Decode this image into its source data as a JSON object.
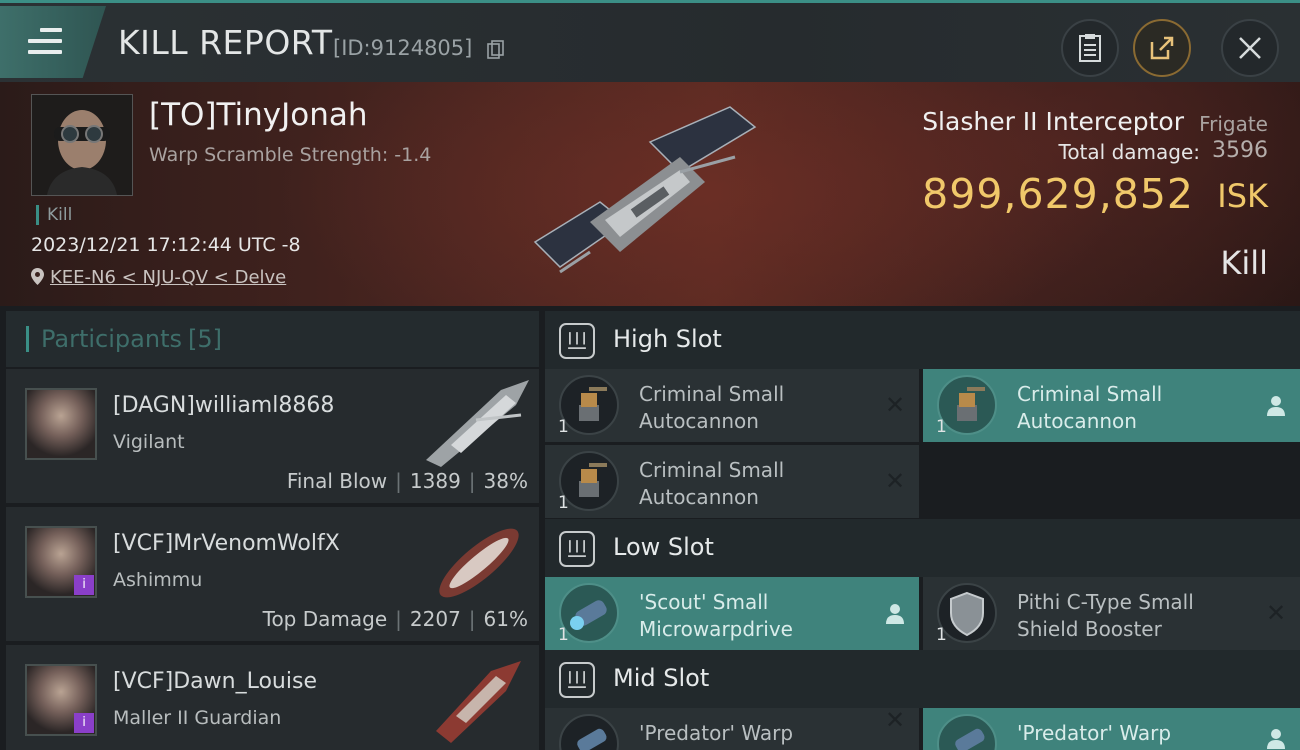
{
  "header": {
    "title": "KILL REPORT",
    "id_text": "[ID:9124805]"
  },
  "victim": {
    "name": "[TO]TinyJonah",
    "warp_scramble": "Warp Scramble Strength: -1.4",
    "tag": "Kill",
    "timestamp": "2023/12/21 17:12:44 UTC -8",
    "location": "KEE-N6 < NJU-QV < Delve",
    "ship": "Slasher II Interceptor",
    "ship_class": "Frigate",
    "total_damage_label": "Total damage:",
    "total_damage": "3596",
    "isk_value": "899,629,852",
    "isk_unit": "ISK",
    "result": "Kill"
  },
  "participants": {
    "label": "Participants",
    "count": "[5]",
    "items": [
      {
        "name": "[DAGN]williaml8868",
        "ship": "Vigilant",
        "role": "Final Blow",
        "damage": "1389",
        "percent": "38%"
      },
      {
        "name": "[VCF]MrVenomWolfX",
        "ship": "Ashimmu",
        "role": "Top Damage",
        "damage": "2207",
        "percent": "61%"
      },
      {
        "name": "[VCF]Dawn_Louise",
        "ship": "Maller II Guardian"
      }
    ]
  },
  "slots": {
    "high": {
      "label": "High Slot",
      "modules": [
        {
          "qty": "1",
          "name_line1": "Criminal Small",
          "name_line2": "Autocannon",
          "status": "dropped"
        },
        {
          "qty": "1",
          "name_line1": "Criminal Small",
          "name_line2": "Autocannon",
          "status": "looted"
        },
        {
          "qty": "1",
          "name_line1": "Criminal Small",
          "name_line2": "Autocannon",
          "status": "dropped"
        }
      ]
    },
    "low": {
      "label": "Low Slot",
      "modules": [
        {
          "qty": "1",
          "name_line1": "'Scout' Small",
          "name_line2": "Microwarpdrive",
          "status": "looted"
        },
        {
          "qty": "1",
          "name_line1": "Pithi C-Type Small",
          "name_line2": "Shield Booster",
          "status": "dropped"
        }
      ]
    },
    "mid": {
      "label": "Mid Slot",
      "modules": [
        {
          "name_line1": "'Predator' Warp",
          "status": "dropped"
        },
        {
          "name_line1": "'Predator' Warp",
          "status": "looted"
        }
      ]
    }
  },
  "colors": {
    "accent": "#3a8f86",
    "isk": "#f0c86a",
    "highlight": "#3f837c"
  }
}
